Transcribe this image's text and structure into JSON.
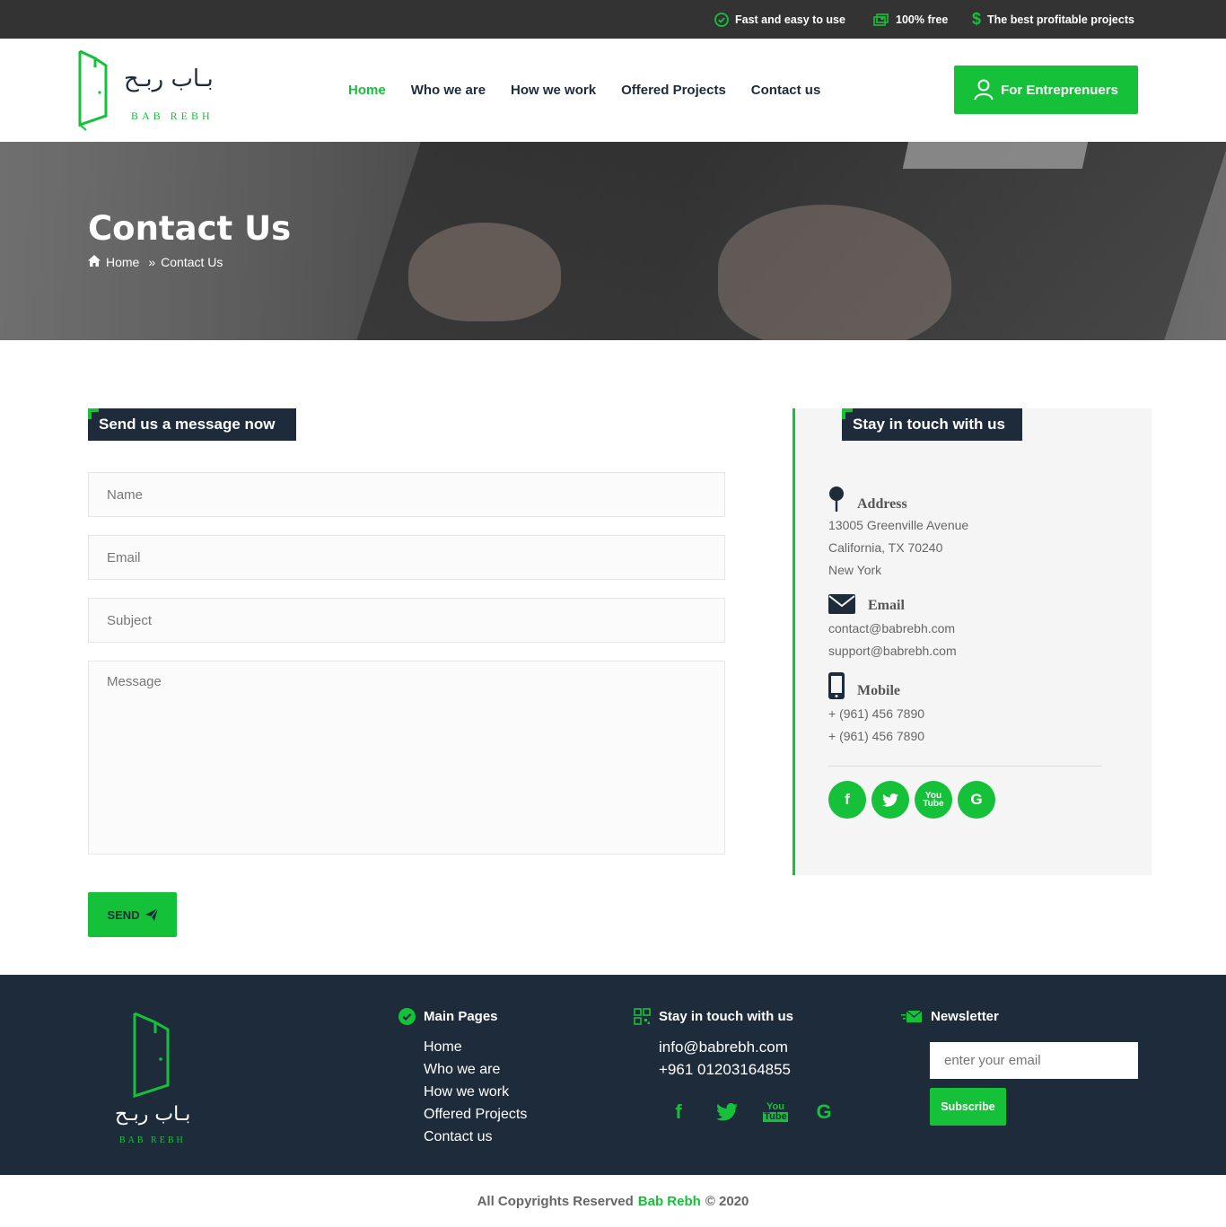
{
  "topbar": {
    "features": [
      {
        "icon": "check-circle-icon",
        "label": "Fast and easy to use"
      },
      {
        "icon": "money-icon",
        "label": "100% free"
      },
      {
        "icon": "dollar-icon",
        "label": "The best profitable projects"
      }
    ]
  },
  "brand": {
    "name_ar": "بـاب ربـح",
    "name_en": "BAB REBH",
    "accent": "#16c13a",
    "dark": "#1e2b3a"
  },
  "nav": {
    "items": [
      "Home",
      "Who we are",
      "How we work",
      "Offered Projects",
      "Contact us"
    ],
    "active": "Home"
  },
  "cta": {
    "label": "For Entreprenuers",
    "icon": "user-icon"
  },
  "hero": {
    "title": "Contact Us",
    "breadcrumb": {
      "home": "Home",
      "current": "Contact Us"
    }
  },
  "form": {
    "title": "Send us a message now",
    "name_placeholder": "Name",
    "email_placeholder": "Email",
    "subject_placeholder": "Subject",
    "message_placeholder": "Message",
    "send_label": "SEND"
  },
  "contact": {
    "title": "Stay in touch with us",
    "address": {
      "label": "Address",
      "lines": [
        "13005 Greenville Avenue",
        "California, TX 70240",
        "New York"
      ]
    },
    "email": {
      "label": "Email",
      "lines": [
        "contact@babrebh.com",
        "support@babrebh.com"
      ]
    },
    "mobile": {
      "label": "Mobile",
      "lines": [
        "+ (961) 456 7890",
        "+ (961) 456 7890"
      ]
    },
    "socials": [
      "facebook-icon",
      "twitter-icon",
      "youtube-icon",
      "google-icon"
    ]
  },
  "footer": {
    "main_pages": {
      "title": "Main Pages",
      "links": [
        "Home",
        "Who we are",
        "How we work",
        "Offered Projects",
        "Contact us"
      ]
    },
    "stay": {
      "title": "Stay in touch with us",
      "email": "info@babrebh.com",
      "phone": "+961 01203164855"
    },
    "newsletter": {
      "title": "Newsletter",
      "placeholder": "enter your email",
      "button": "Subscribe"
    }
  },
  "copyright": {
    "prefix": "All Copyrights Reserved",
    "brand": "Bab Rebh",
    "suffix": "© 2020"
  }
}
